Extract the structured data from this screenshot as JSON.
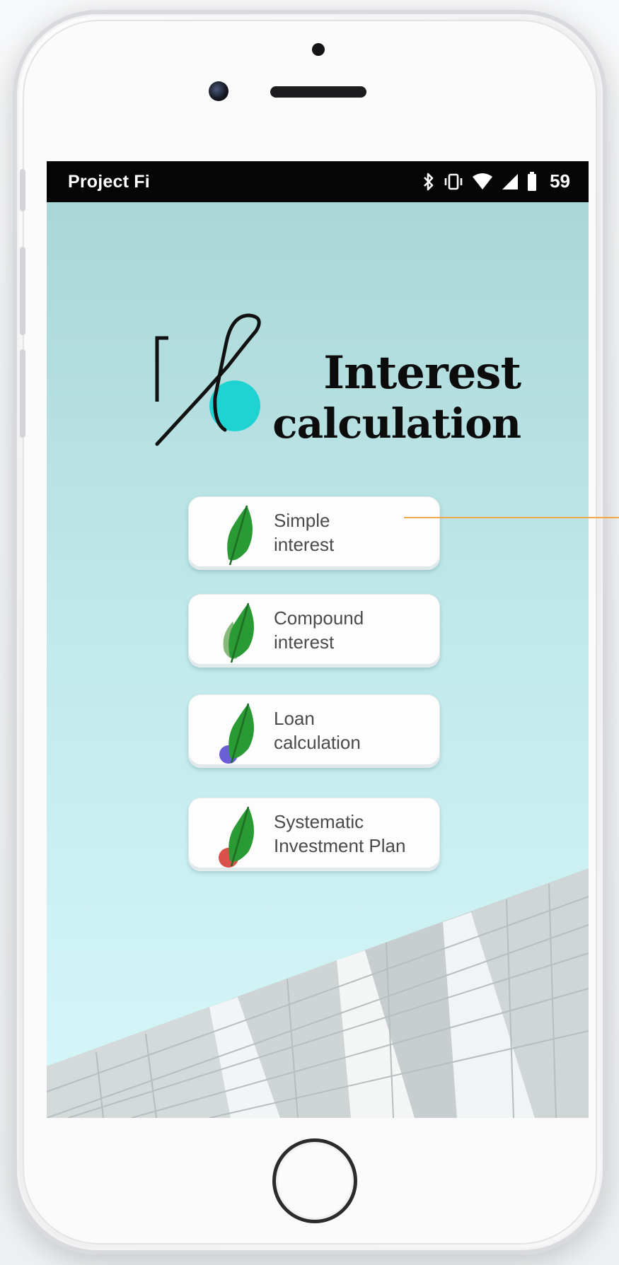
{
  "status_bar": {
    "carrier": "Project Fi",
    "time": "59",
    "icons": [
      "bluetooth-icon",
      "vibrate-icon",
      "wifi-icon",
      "signal-icon",
      "battery-icon"
    ]
  },
  "app": {
    "title_line1": "Interest",
    "title_line2": "calculation",
    "accent_color": "#1fd3d3"
  },
  "menu": [
    {
      "line1": "Simple",
      "line2": "interest",
      "icon": "leaf-icon"
    },
    {
      "line1": "Compound",
      "line2": "interest",
      "icon": "double-leaf-icon"
    },
    {
      "line1": "Loan",
      "line2": "calculation",
      "icon": "leaf-purple-circle-icon"
    },
    {
      "line1": "Systematic",
      "line2": "Investment Plan",
      "icon": "leaf-red-circle-icon"
    }
  ],
  "colors": {
    "leaf_green": "#2a9a34",
    "loan_circle": "#6a5fd6",
    "sip_circle": "#d9514a",
    "callout": "#f0a848"
  }
}
